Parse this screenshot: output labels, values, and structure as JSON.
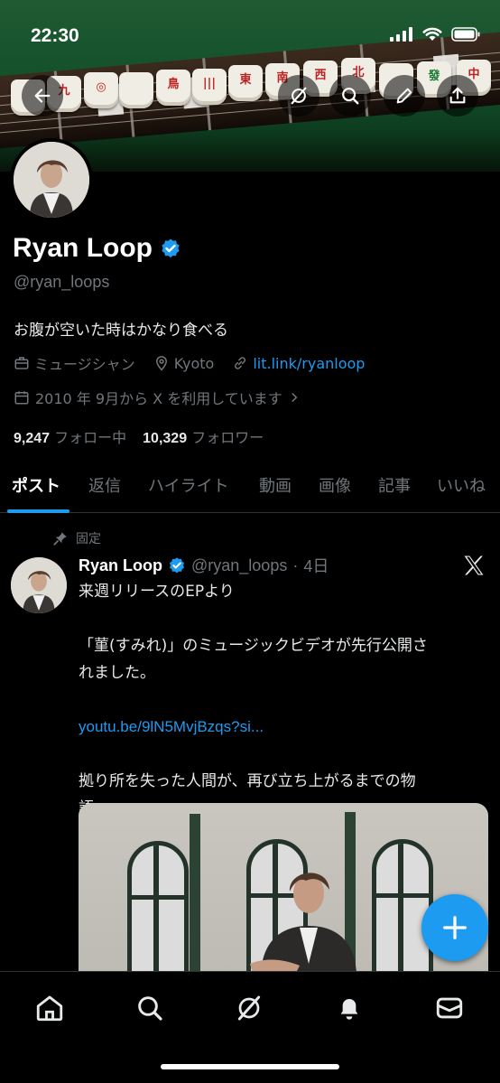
{
  "status_bar": {
    "time": "22:30"
  },
  "banner": {
    "tiles": [
      "",
      "九",
      "◎",
      "",
      "鳥",
      "|||",
      "東",
      "南",
      "西",
      "北",
      "",
      "發",
      "中"
    ]
  },
  "profile": {
    "name": "Ryan Loop",
    "handle": "@ryan_loops",
    "bio": "お腹が空いた時はかなり食べる",
    "category": "ミュージシャン",
    "location": "Kyoto",
    "link": "lit.link/ryanloop",
    "joined": "2010 年 9月から X を利用しています",
    "following_count": "9,247",
    "following_label": "フォロー中",
    "followers_count": "10,329",
    "followers_label": "フォロワー"
  },
  "tabs": [
    "ポスト",
    "返信",
    "ハイライト",
    "動画",
    "画像",
    "記事",
    "いいね"
  ],
  "pinned_post": {
    "pinned_label": "固定",
    "author_name": "Ryan Loop",
    "author_handle": "@ryan_loops",
    "sep": "·",
    "time": "4日",
    "lines": [
      "来週リリースのEPより",
      "",
      "「菫(すみれ)」のミュージックビデオが先行公開さ",
      "れました。",
      "",
      "",
      "",
      "拠り所を失った人間が、再び立ち上がるまでの物",
      "語。"
    ],
    "url": "youtu.be/9lN5MvjBzqs?si..."
  },
  "colors": {
    "accent": "#1d9bf0",
    "background": "#000000",
    "muted": "#71767b"
  }
}
